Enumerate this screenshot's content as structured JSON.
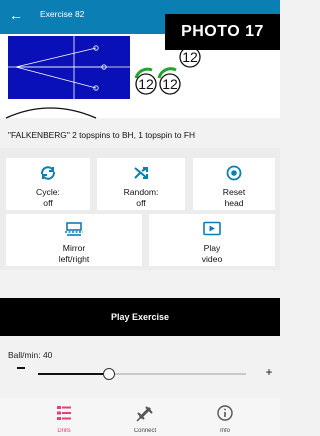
{
  "topbar": {
    "back_icon": "arrow-left-icon",
    "title": "Exercise 82"
  },
  "overlay": {
    "label": "PHOTO 17"
  },
  "drill": {
    "ball_badges": [
      "12",
      "12",
      "12"
    ],
    "name": "\"FALKENBERG\" 2 topspins to BH, 1 topspin to FH"
  },
  "controls": {
    "cycle": {
      "icon": "sync-icon",
      "label_line1": "Cycle:",
      "label_line2": "off"
    },
    "random": {
      "icon": "shuffle-icon",
      "label_line1": "Random:",
      "label_line2": "off"
    },
    "reset": {
      "icon": "target-icon",
      "label_line1": "Reset",
      "label_line2": "head"
    },
    "mirror": {
      "icon": "mirror-icon",
      "label_line1": "Mirror",
      "label_line2": "left/right"
    },
    "video": {
      "icon": "play-video-icon",
      "label_line1": "Play",
      "label_line2": "video"
    }
  },
  "play_button": {
    "label": "Play Exercise"
  },
  "speed": {
    "label": "Ball/min: 40",
    "value_fraction": 0.34
  },
  "bottom_nav": [
    {
      "icon": "list-icon",
      "label": "Drills",
      "color": "#e83e7a"
    },
    {
      "icon": "plug-icon",
      "label": "Connect",
      "color": "#555555"
    },
    {
      "icon": "info-icon",
      "label": "Info",
      "color": "#555555"
    }
  ],
  "colors": {
    "header": "#0b7fb4",
    "diagram_bg": "#0a10b8",
    "accent_green": "#22a52a"
  }
}
